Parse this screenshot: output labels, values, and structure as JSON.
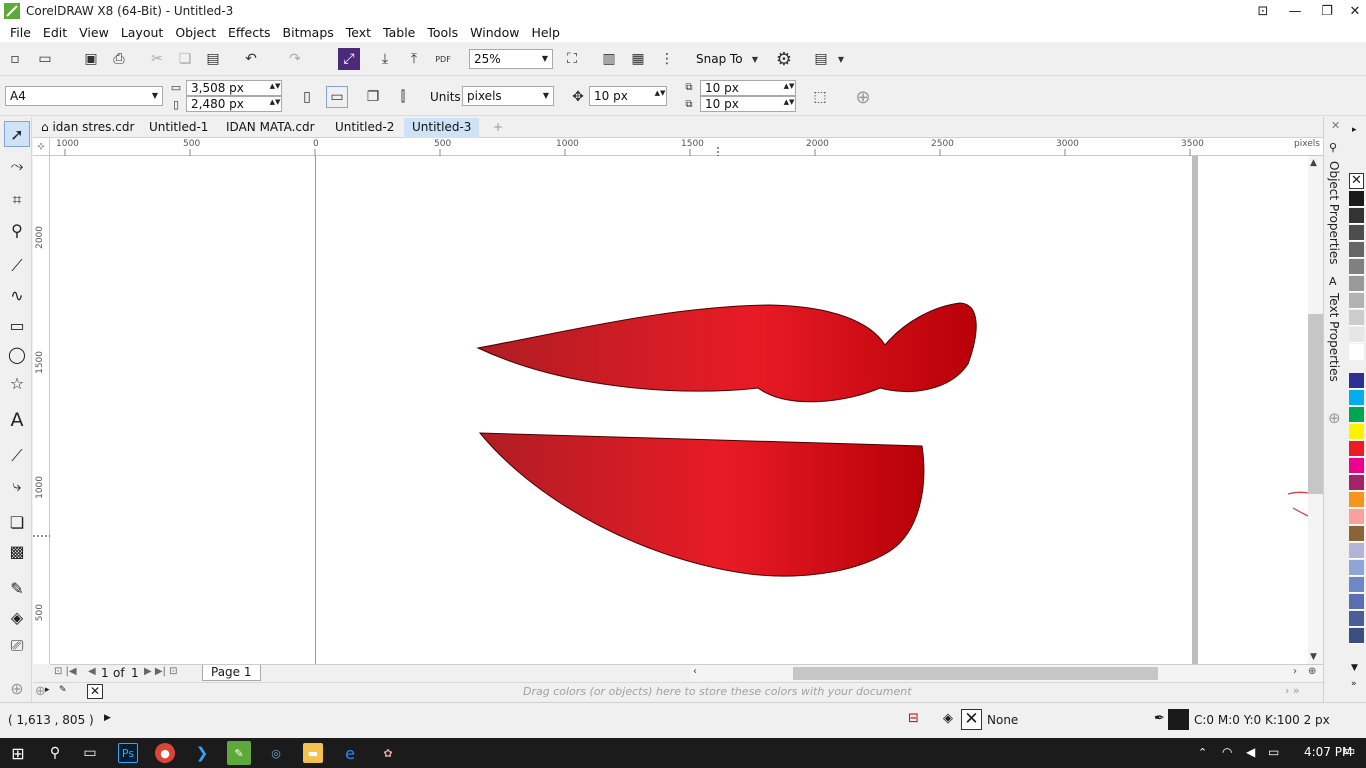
{
  "window": {
    "title": "CorelDRAW X8 (64-Bit) - Untitled-3"
  },
  "menu": [
    "File",
    "Edit",
    "View",
    "Layout",
    "Object",
    "Effects",
    "Bitmaps",
    "Text",
    "Table",
    "Tools",
    "Window",
    "Help"
  ],
  "standard_toolbar": {
    "zoom": "25%",
    "snap_to": "Snap To"
  },
  "property_bar": {
    "page_size": "A4",
    "width": "3,508 px",
    "height": "2,480 px",
    "units_label": "Units:",
    "units": "pixels",
    "nudge": "10 px",
    "dup_x": "10 px",
    "dup_y": "10 px"
  },
  "doc_tabs": [
    "idan stres.cdr",
    "Untitled-1",
    "IDAN MATA.cdr",
    "Untitled-2",
    "Untitled-3"
  ],
  "ruler": {
    "h_labels": [
      "1000",
      "500",
      "0",
      "500",
      "1000",
      "1500",
      "2000",
      "2500",
      "3000",
      "3500"
    ],
    "h_unit": "pixels",
    "v_labels": [
      "2000",
      "1500",
      "1000",
      "500"
    ]
  },
  "page_nav": {
    "current": "1",
    "of_label": "of",
    "total": "1",
    "page_tab": "Page 1"
  },
  "doc_palette": {
    "hint": "Drag colors (or objects) here to store these colors with your document"
  },
  "status": {
    "coords": "( 1,613 , 805  )",
    "fill": "None",
    "outline": "C:0 M:0 Y:0 K:100  2 px"
  },
  "dockers": {
    "object_properties": "Object Properties",
    "text_properties": "Text Properties"
  },
  "palette_colors": [
    "#1a1a1a",
    "#333333",
    "#4d4d4d",
    "#666666",
    "#808080",
    "#999999",
    "#b3b3b3",
    "#cccccc",
    "#e6e6e6",
    "#ffffff",
    "#2e3192",
    "#00aeef",
    "#00a651",
    "#fff200",
    "#ed1c24",
    "#ec008c",
    "#a3226a",
    "#f7941d",
    "#f9a19a",
    "#8c6239",
    "#b4b4d9",
    "#8fa5d6",
    "#6f87c4",
    "#5a6fb1",
    "#4b5c9a",
    "#3c4d82"
  ],
  "shape_colors": {
    "dark": "#b01d24",
    "bright": "#e81b25",
    "deep": "#b80008"
  },
  "taskbar": {
    "time": "4:07 PM"
  }
}
